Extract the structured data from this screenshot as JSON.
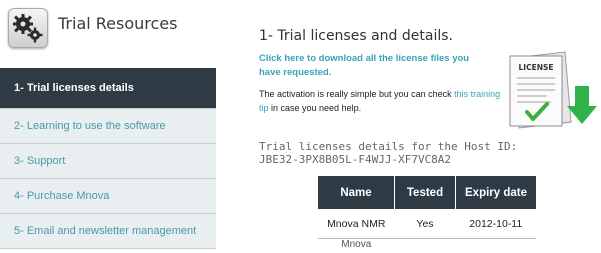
{
  "app": {
    "title": "Trial Resources",
    "brand_icon": "gears-icon"
  },
  "sidebar": {
    "items": [
      {
        "label": "1- Trial licenses details",
        "active": true
      },
      {
        "label": "2- Learning to use the software",
        "active": false
      },
      {
        "label": "3- Support",
        "active": false
      },
      {
        "label": "4- Purchase Mnova",
        "active": false
      },
      {
        "label": "5- Email and newsletter management",
        "active": false
      }
    ]
  },
  "main": {
    "title": "1- Trial licenses and details.",
    "download_link": "Click here to download all the license files you have requested.",
    "note_prefix": "The activation is really simple but you can check ",
    "note_link": "this training tip",
    "note_suffix": " in case you need help.",
    "license_image": {
      "label": "LICENSE",
      "icon": "license-download-icon"
    },
    "host_label": "Trial licenses details for the Host ID:",
    "host_id": "JBE32-3PX8B05L-F4WJJ-XF7VC8A2",
    "table": {
      "headers": [
        "Name",
        "Tested",
        "Expiry date"
      ],
      "rows": [
        [
          "Mnova NMR",
          "Yes",
          "2012-10-11"
        ],
        [
          "Mnova",
          "",
          ""
        ]
      ]
    }
  },
  "colors": {
    "accent": "#3aa3b8",
    "dark": "#2e3a44",
    "nav_bg": "#e9eef1",
    "arrow": "#2fb24a"
  }
}
